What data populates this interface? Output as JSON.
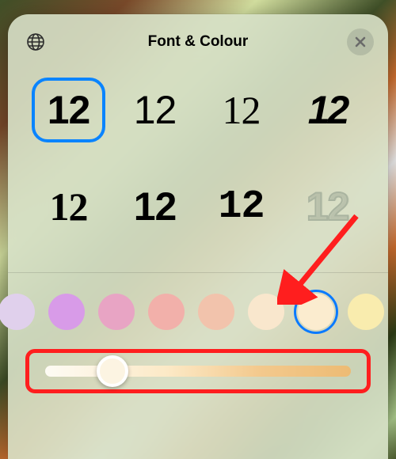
{
  "header": {
    "title": "Font & Colour"
  },
  "fonts": {
    "sample_text": "12",
    "selected_index": 0,
    "count": 8
  },
  "colors": {
    "swatches": [
      "#e0d0ec",
      "#d89be8",
      "#e8a4c4",
      "#f2b0aa",
      "#f2c3ac",
      "#f9e7cd",
      "#fbeccf",
      "#f9ecae"
    ],
    "selected_index": 6
  },
  "slider": {
    "value_pct": 22,
    "gradient_left": "#fdfbf4",
    "gradient_right": "#edbb74",
    "thumb_fill": "#fcf4e2"
  },
  "annotation": {
    "arrow_target": "color-swatch-6",
    "highlight_target": "intensity-slider"
  }
}
